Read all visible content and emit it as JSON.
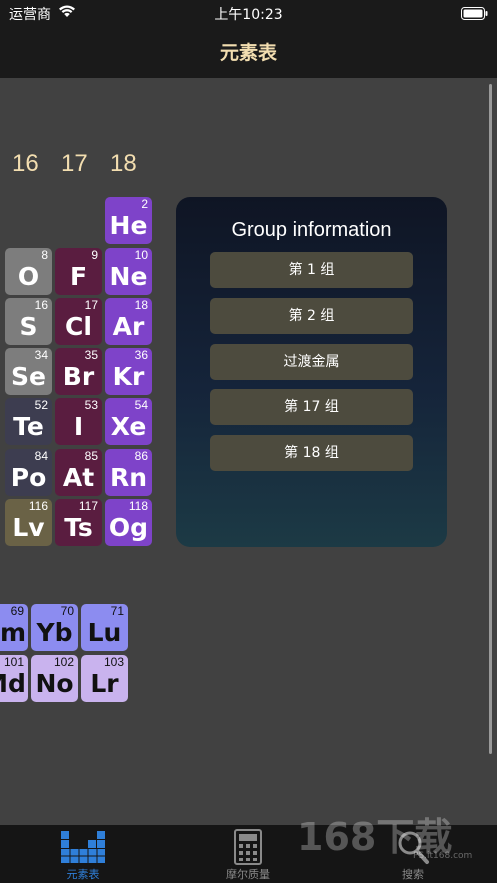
{
  "status_bar": {
    "carrier": "运营商",
    "time": "上午10:23"
  },
  "nav": {
    "title": "元素表"
  },
  "group_numbers": [
    "16",
    "17",
    "18"
  ],
  "elements": [
    {
      "symbol": "He",
      "number": "2"
    },
    {
      "symbol": "O",
      "number": "8"
    },
    {
      "symbol": "F",
      "number": "9"
    },
    {
      "symbol": "Ne",
      "number": "10"
    },
    {
      "symbol": "S",
      "number": "16"
    },
    {
      "symbol": "Cl",
      "number": "17"
    },
    {
      "symbol": "Ar",
      "number": "18"
    },
    {
      "symbol": "Se",
      "number": "34"
    },
    {
      "symbol": "Br",
      "number": "35"
    },
    {
      "symbol": "Kr",
      "number": "36"
    },
    {
      "symbol": "Te",
      "number": "52"
    },
    {
      "symbol": "I",
      "number": "53"
    },
    {
      "symbol": "Xe",
      "number": "54"
    },
    {
      "symbol": "Po",
      "number": "84"
    },
    {
      "symbol": "At",
      "number": "85"
    },
    {
      "symbol": "Rn",
      "number": "86"
    },
    {
      "symbol": "Lv",
      "number": "116"
    },
    {
      "symbol": "Ts",
      "number": "117"
    },
    {
      "symbol": "Og",
      "number": "118"
    },
    {
      "symbol": "Tm",
      "number": "69"
    },
    {
      "symbol": "Yb",
      "number": "70"
    },
    {
      "symbol": "Lu",
      "number": "71"
    },
    {
      "symbol": "Md",
      "number": "101"
    },
    {
      "symbol": "No",
      "number": "102"
    },
    {
      "symbol": "Lr",
      "number": "103"
    }
  ],
  "panel": {
    "title": "Group information",
    "buttons": [
      "第 1 组",
      "第 2 组",
      "过渡金属",
      "第 17 组",
      "第 18 组"
    ]
  },
  "tabs": [
    {
      "label": "元素表",
      "icon": "table-icon",
      "active": true
    },
    {
      "label": "摩尔质量",
      "icon": "calculator-icon",
      "active": false
    },
    {
      "label": "搜索",
      "icon": "search-icon",
      "active": false
    }
  ],
  "watermark": {
    "brand": "168下载",
    "url": "PS.it168.com"
  },
  "colors": {
    "background": "#414141",
    "nav_title": "#f3deb0",
    "noble_gas": "#7e43c9",
    "halogen": "#5a1d40",
    "nonmetal": "#7d7d7d",
    "metalloid": "#3d3d50",
    "unknown": "#6a6246",
    "lanthanide": "#8c8cf0",
    "actinide": "#c9b3ee",
    "tab_active": "#2f7fd9",
    "tab_inactive": "#8a8a8a"
  }
}
